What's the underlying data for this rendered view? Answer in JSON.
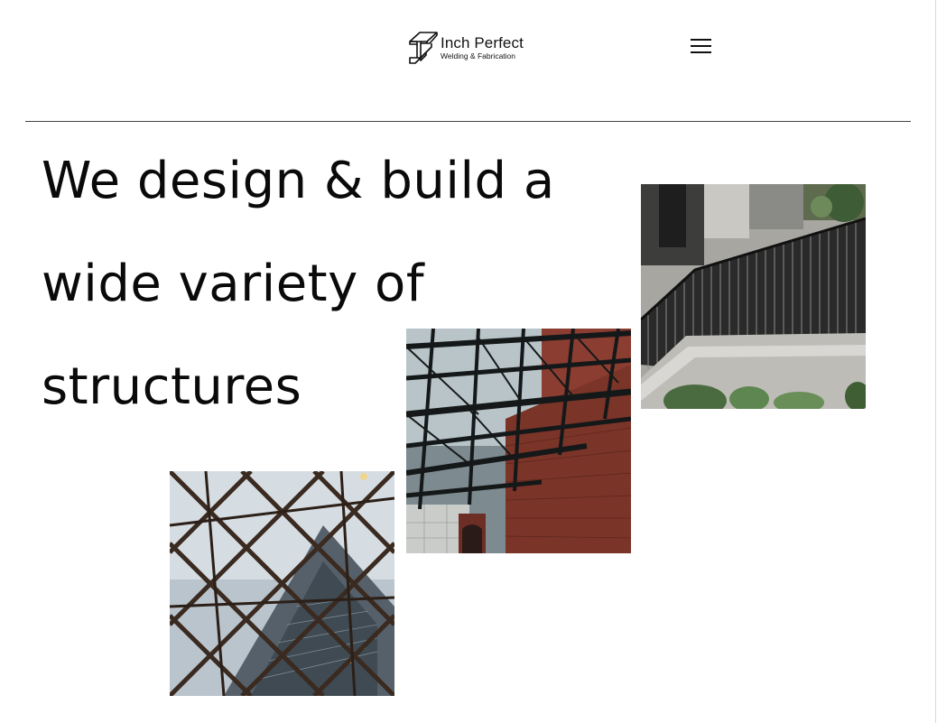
{
  "header": {
    "brand_name": "Inch Perfect",
    "brand_tagline": "Welding & Fabrication",
    "logo_icon": "i-beam-icon",
    "menu_icon": "hamburger-menu-icon"
  },
  "hero": {
    "headline": "We design & build a wide variety of structures"
  },
  "gallery": {
    "photos": [
      {
        "subject": "metal-railing-photo"
      },
      {
        "subject": "steel-roof-truss-photo"
      },
      {
        "subject": "glass-steel-atrium-photo"
      }
    ]
  },
  "colors": {
    "text": "#0a0a0a",
    "background": "#ffffff",
    "divider": "#444444"
  }
}
